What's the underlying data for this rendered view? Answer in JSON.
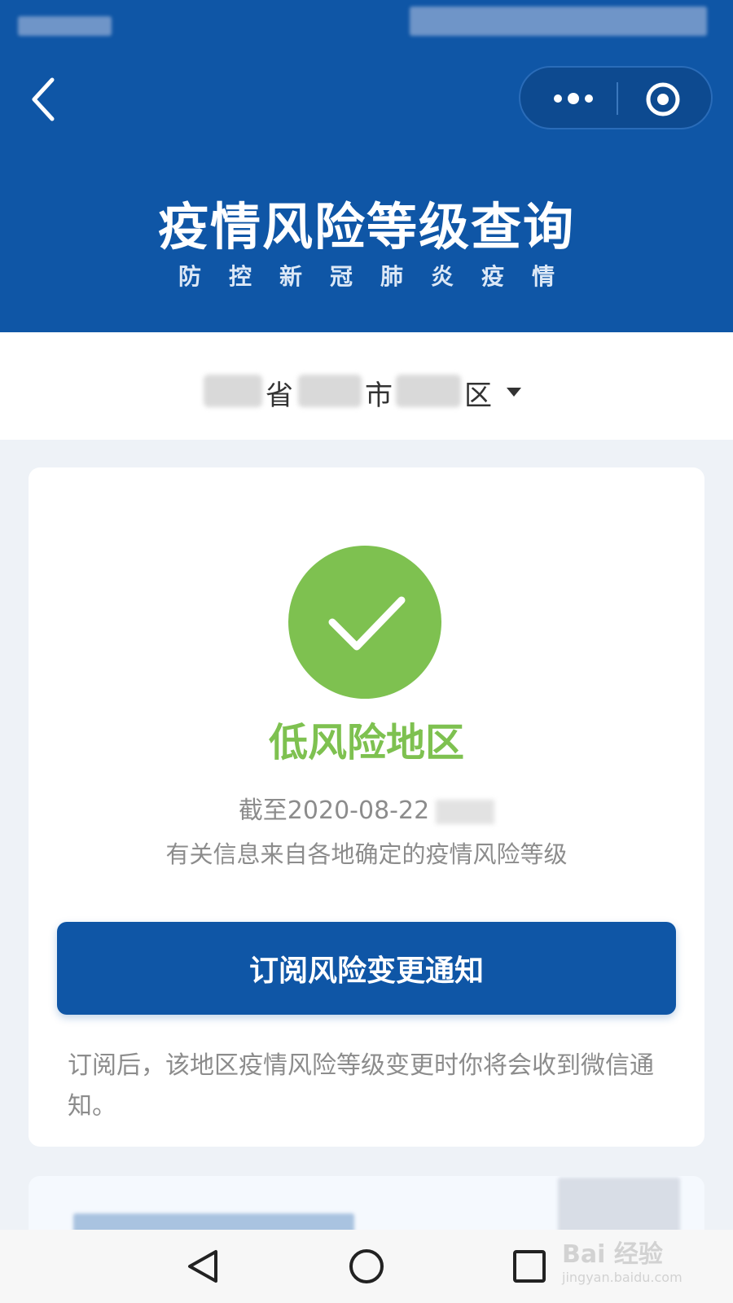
{
  "header": {
    "title": "疫情风险等级查询",
    "subtitle": "防控新冠肺炎疫情"
  },
  "region": {
    "province_suffix": "省",
    "city_suffix": "市",
    "district_suffix": "区"
  },
  "result": {
    "level": "低风险地区",
    "level_color": "#7ec150",
    "date_prefix": "截至2020-08-22",
    "info": "有关信息来自各地确定的疫情风险等级"
  },
  "subscribe": {
    "button_label": "订阅风险变更通知",
    "note": "订阅后，该地区疫情风险等级变更时你将会收到微信通知。"
  },
  "colors": {
    "primary": "#0f56a6",
    "success": "#7ec150"
  },
  "watermark": {
    "brand": "Bai 经验",
    "url": "jingyan.baidu.com"
  }
}
